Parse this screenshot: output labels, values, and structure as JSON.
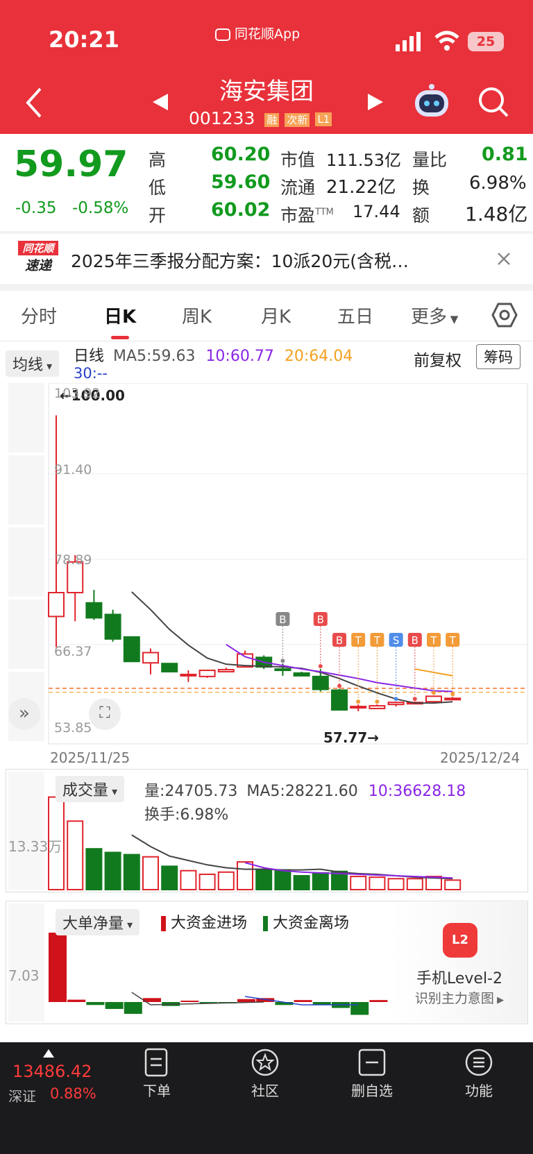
{
  "status_bar": {
    "time": "20:21",
    "app_badge": "同花顺App",
    "battery": "25"
  },
  "header": {
    "stock_name": "海安集团",
    "stock_code": "001233",
    "tags": [
      "融",
      "次新",
      "L1"
    ],
    "prev_icon": "triangle-left-icon",
    "next_icon": "triangle-right-icon",
    "back_icon": "chevron-left-icon",
    "search_icon": "search-icon",
    "robot_icon": "robot-icon"
  },
  "quote": {
    "price": "59.97",
    "change": "-0.35",
    "change_pct": "-0.58%",
    "high_label": "高",
    "high": "60.20",
    "low_label": "低",
    "low": "59.60",
    "open_label": "开",
    "open": "60.02",
    "mcap_label": "市值",
    "mcap": "111.53亿",
    "float_label": "流通",
    "float": "21.22亿",
    "pe_label": "市盈",
    "pe_sup": "TTM",
    "pe": "17.44",
    "vr_label": "量比",
    "vr": "0.81",
    "turn_label": "换",
    "turn": "6.98%",
    "amt_label": "额",
    "amt": "1.48亿"
  },
  "news": {
    "logo_top": "同花顺",
    "logo_bottom": "速递",
    "text": "2025年三季报分配方案：10派20元(含税…",
    "close_icon": "close-icon"
  },
  "tabs": [
    "分时",
    "日K",
    "周K",
    "月K",
    "五日",
    "更多"
  ],
  "active_tab": 1,
  "kline_header": {
    "ma_dropdown": "均线",
    "period": "日线",
    "ma5": "MA5:59.63",
    "ma10": "10:60.77",
    "ma20": "20:64.04",
    "ma30": "30:--",
    "adjust": "前复权",
    "chips": "筹码"
  },
  "price_axis": [
    "103.92",
    "91.40",
    "78.89",
    "66.37",
    "53.85"
  ],
  "chart_labels": {
    "max": "←100.00",
    "min": "57.77→",
    "start_date": "2025/11/25",
    "end_date": "2025/12/24"
  },
  "chart_data": {
    "type": "candlestick",
    "x": [
      "2025/11/25",
      "",
      "",
      "",
      "",
      "",
      "",
      "",
      "",
      "",
      "",
      "",
      "",
      "",
      "",
      "",
      "",
      "",
      "",
      "",
      "",
      "",
      "",
      "2025/12/24"
    ],
    "candles": [
      {
        "o": 70.5,
        "c": 74.0,
        "h": 100.0,
        "l": 66.0
      },
      {
        "o": 74.0,
        "c": 78.5,
        "h": 79.5,
        "l": 69.8
      },
      {
        "o": 72.5,
        "c": 70.3,
        "h": 74.4,
        "l": 70.0
      },
      {
        "o": 70.8,
        "c": 67.2,
        "h": 71.5,
        "l": 66.8
      },
      {
        "o": 67.5,
        "c": 63.9,
        "h": 67.6,
        "l": 63.9
      },
      {
        "o": 63.7,
        "c": 65.2,
        "h": 65.8,
        "l": 62.0
      },
      {
        "o": 63.6,
        "c": 62.4,
        "h": 63.6,
        "l": 62.4
      },
      {
        "o": 61.9,
        "c": 62.0,
        "h": 62.6,
        "l": 60.9
      },
      {
        "o": 61.7,
        "c": 62.6,
        "h": 62.7,
        "l": 61.5
      },
      {
        "o": 62.4,
        "c": 62.7,
        "h": 63.0,
        "l": 62.3
      },
      {
        "o": 63.1,
        "c": 65.0,
        "h": 65.5,
        "l": 63.0
      },
      {
        "o": 64.5,
        "c": 63.1,
        "h": 64.8,
        "l": 62.8
      },
      {
        "o": 62.8,
        "c": 62.7,
        "h": 63.6,
        "l": 61.8
      },
      {
        "o": 62.2,
        "c": 61.8,
        "h": 62.4,
        "l": 61.8
      },
      {
        "o": 61.7,
        "c": 59.8,
        "h": 62.8,
        "l": 59.5
      },
      {
        "o": 59.7,
        "c": 56.8,
        "h": 59.9,
        "l": 56.7
      },
      {
        "o": 57.2,
        "c": 57.3,
        "h": 57.6,
        "l": 56.6
      },
      {
        "o": 57.0,
        "c": 57.4,
        "h": 57.6,
        "l": 57.0
      },
      {
        "o": 57.6,
        "c": 57.9,
        "h": 58.0,
        "l": 57.3
      },
      {
        "o": 57.9,
        "c": 57.9,
        "h": 58.0,
        "l": 57.8
      },
      {
        "o": 58.0,
        "c": 58.8,
        "h": 58.9,
        "l": 57.7
      },
      {
        "o": 58.4,
        "c": 58.5,
        "h": 58.7,
        "l": 58.3
      }
    ],
    "ma5": [
      null,
      null,
      null,
      null,
      74.1,
      71.5,
      68.6,
      66.3,
      64.4,
      63.5,
      63.3,
      63.2,
      63.1,
      62.9,
      62.3,
      61.4,
      60.3,
      59.3,
      58.4,
      57.8,
      57.8,
      58.0
    ],
    "ma10": [
      null,
      null,
      null,
      null,
      null,
      null,
      null,
      null,
      null,
      66.4,
      64.6,
      63.8,
      63.3,
      62.8,
      62.4,
      61.9,
      61.4,
      60.8,
      60.4,
      60.0,
      59.6,
      59.5
    ],
    "signals": [
      {
        "i": 12,
        "label": "B"
      },
      {
        "i": 14,
        "label": "B"
      },
      {
        "i": 15,
        "label": "B"
      },
      {
        "i": 16,
        "label": "T"
      },
      {
        "i": 17,
        "label": "T"
      },
      {
        "i": 18,
        "label": "S"
      },
      {
        "i": 19,
        "label": "B"
      },
      {
        "i": 20,
        "label": "T"
      },
      {
        "i": 21,
        "label": "T"
      }
    ],
    "ylim": [
      53.85,
      103.92
    ],
    "volume": [
      12.7,
      9.4,
      5.6,
      5.1,
      4.8,
      4.5,
      3.2,
      2.6,
      2.1,
      2.4,
      3.8,
      2.8,
      2.7,
      1.9,
      2.3,
      2.5,
      1.8,
      1.7,
      1.5,
      1.5,
      1.8,
      1.3
    ],
    "volume_unit": "万",
    "big_order": [
      7.03,
      0.24,
      -0.3,
      -0.7,
      -1.2,
      0.4,
      -0.4,
      0.1,
      -0.1,
      -0.05,
      0.3,
      0.4,
      -0.3,
      0.2,
      -0.3,
      -0.6,
      -1.3,
      0.2
    ],
    "colors": {
      "up": "#e0242c",
      "down": "#127a1e",
      "ma5": "#444444",
      "ma10": "#8a25e6",
      "ma20": "#f4a020"
    }
  },
  "volume_panel": {
    "dropdown": "成交量",
    "vol": "量:24705.73",
    "ma5": "MA5:28221.60",
    "ma10": "10:36628.18",
    "turnover": "换手:6.98%",
    "axis": "13.33万"
  },
  "bigorder_panel": {
    "dropdown": "大单净量",
    "in_label": "大资金进场",
    "out_label": "大资金离场",
    "axis": "7.03"
  },
  "level2": {
    "title": "手机Level-2",
    "sub": "识别主力意图"
  },
  "bottom": {
    "index_value": "13486.42",
    "index_name": "深证",
    "index_pct": "0.88%",
    "nav": [
      "下单",
      "社区",
      "删自选",
      "功能"
    ]
  }
}
